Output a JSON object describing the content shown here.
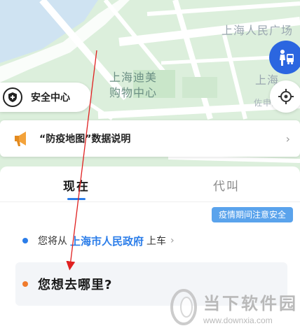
{
  "map": {
    "labels": {
      "dimei": "上海迪美\n购物中心",
      "guangchang": "上海人民广场",
      "shanghai2": "上海",
      "small": "佐申路"
    }
  },
  "safety_button": {
    "label": "安全中心"
  },
  "notice": {
    "text": "“防疫地图”数据说明"
  },
  "tabs": {
    "now": "现在",
    "proxy": "代叫"
  },
  "badge": "疫情期间注意安全",
  "pickup": {
    "prefix": "您将从",
    "place": "上海市人民政府",
    "suffix": "上车"
  },
  "destination": {
    "placeholder": "您想去哪里?"
  },
  "watermark": {
    "title": "当下软件园",
    "url": "www.downxia.com"
  },
  "colors": {
    "accent": "#2b7de9",
    "orange": "#f07b2d",
    "badge": "#5aa3ec",
    "map": "#dcefdc"
  }
}
